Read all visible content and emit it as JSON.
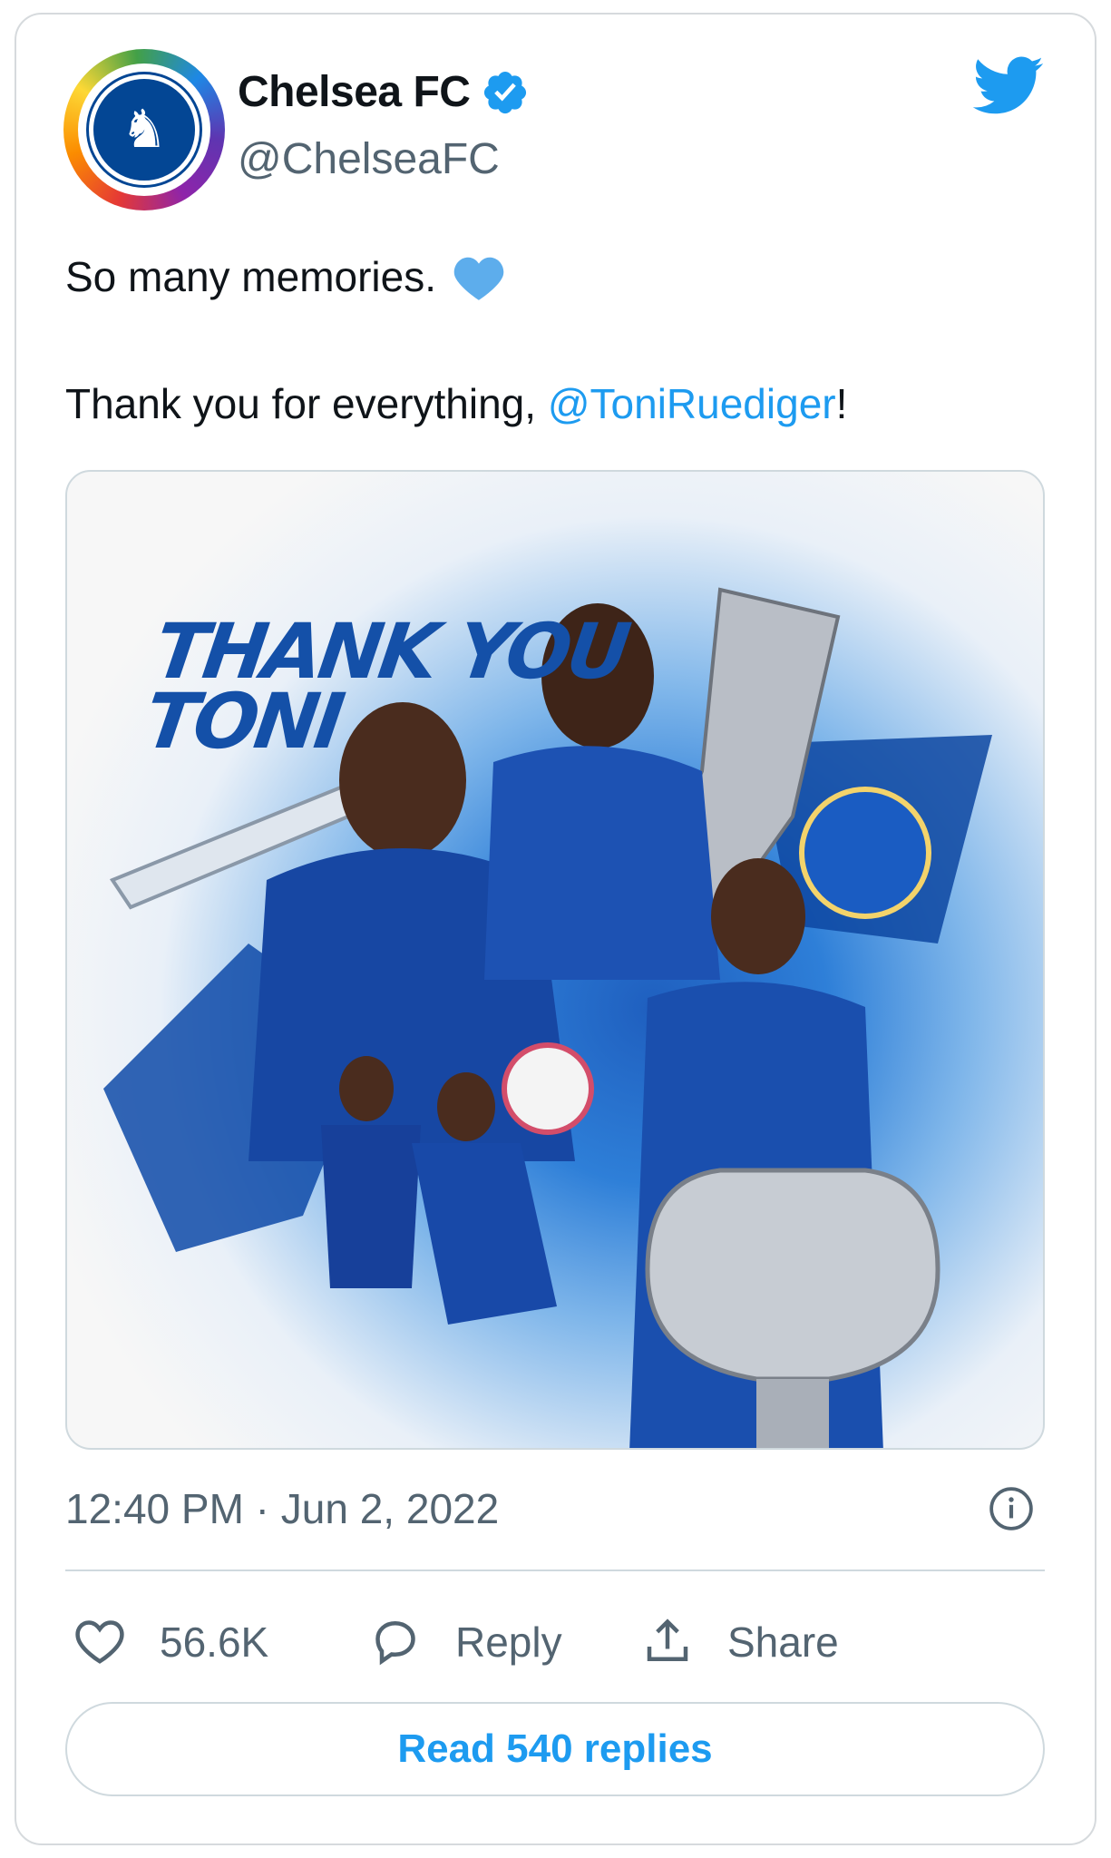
{
  "author": {
    "display_name": "Chelsea FC",
    "handle": "@ChelseaFC",
    "verified": true,
    "avatar_icon": "chelsea-crest-rainbow-icon"
  },
  "header": {
    "platform_icon": "twitter-bird-icon",
    "brand_color": "#1d9bf0"
  },
  "tweet": {
    "line1": "So many memories.",
    "line1_emoji": "blue-heart-emoji",
    "line2_prefix": "Thank you for everything, ",
    "line2_mention": "@ToniRuediger",
    "line2_suffix": "!"
  },
  "media": {
    "title_line1": "THANK YOU",
    "title_line2": "TONI",
    "image_subject": "Antonio Rüdiger in Chelsea kit with trophies"
  },
  "meta": {
    "timestamp": "12:40 PM · Jun 2, 2022",
    "info_icon": "info-circle-icon"
  },
  "actions": {
    "like_count": "56.6K",
    "reply_label": "Reply",
    "share_label": "Share"
  },
  "footer": {
    "read_replies": "Read 540 replies"
  },
  "colors": {
    "text": "#0f1419",
    "secondary": "#536471",
    "link": "#1d9bf0",
    "border": "#cfd9de",
    "chelsea_blue": "#034694"
  }
}
